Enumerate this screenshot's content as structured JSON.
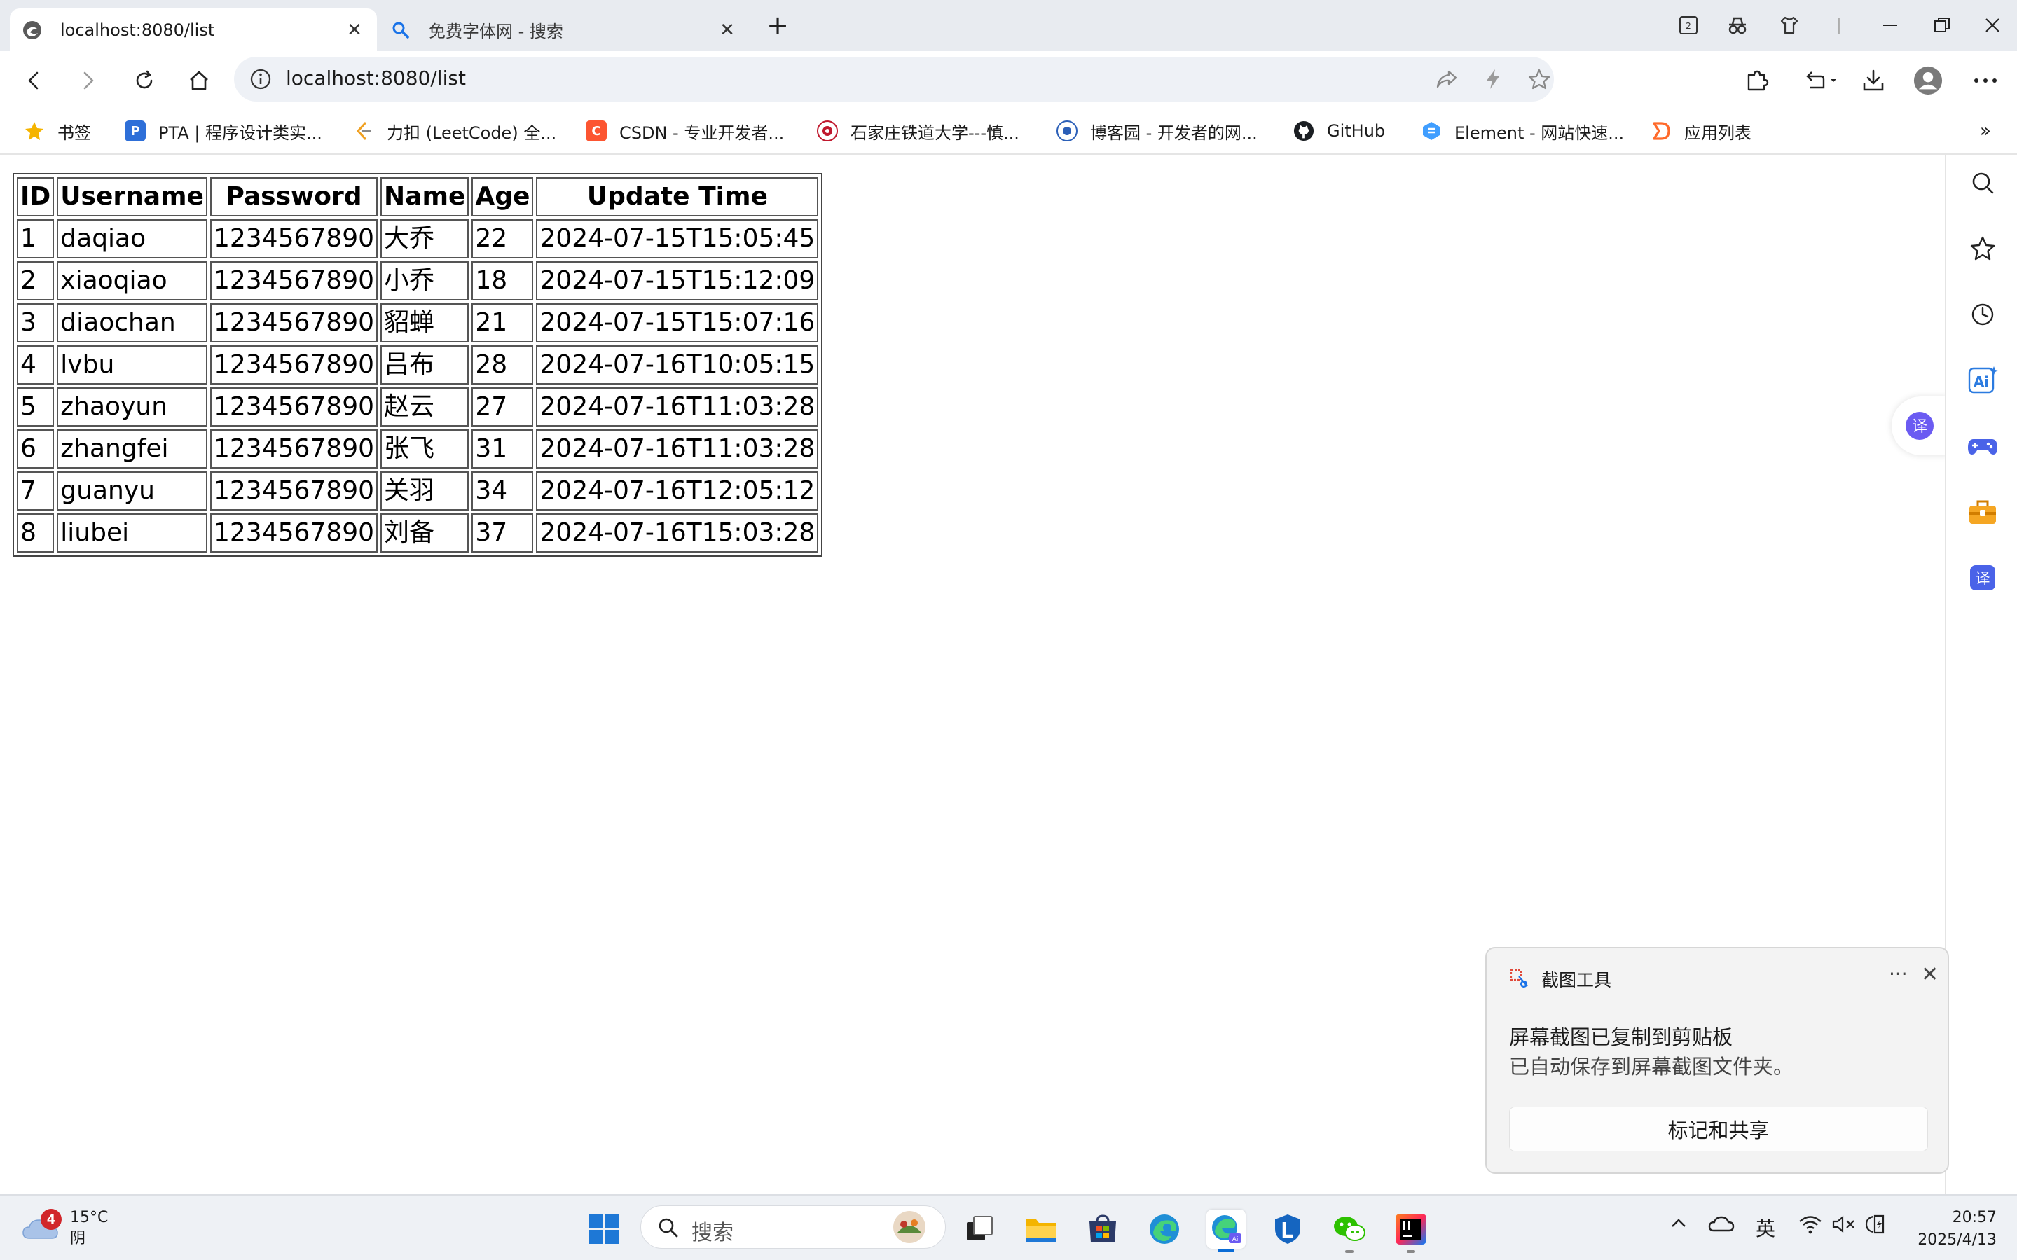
{
  "browser": {
    "tabs": [
      {
        "title": "localhost:8080/list",
        "active": true
      },
      {
        "title": "免费字体网 - 搜索",
        "active": false
      }
    ],
    "address": "localhost:8080/list",
    "icons": {
      "back": "back-arrow-icon",
      "forward": "forward-arrow-icon",
      "refresh": "refresh-icon",
      "home": "home-icon",
      "info": "info-icon",
      "share": "share-icon",
      "bolt": "lightning-icon",
      "favorite": "star-icon",
      "extensions": "puzzle-icon",
      "history": "history-icon",
      "download": "download-icon",
      "profile": "avatar-icon",
      "menu": "more-icon"
    }
  },
  "bookmarks": [
    {
      "label": "书签",
      "color": "#f5b400"
    },
    {
      "label": "PTA | 程序设计类实...",
      "color": "#2e6fd8"
    },
    {
      "label": "力扣 (LeetCode) 全...",
      "color": "#f0a020"
    },
    {
      "label": "CSDN - 专业开发者...",
      "color": "#fc5531"
    },
    {
      "label": "石家庄铁道大学---慎...",
      "color": "#c0182d"
    },
    {
      "label": "博客园 - 开发者的网...",
      "color": "#2b5fb8"
    },
    {
      "label": "GitHub",
      "color": "#1b1f23"
    },
    {
      "label": "Element - 网站快速...",
      "color": "#409eff"
    },
    {
      "label": "应用列表",
      "color": "#ff6a2b"
    }
  ],
  "bookmarks_overflow": "»",
  "table": {
    "headers": [
      "ID",
      "Username",
      "Password",
      "Name",
      "Age",
      "Update Time"
    ],
    "rows": [
      [
        "1",
        "daqiao",
        "1234567890",
        "大乔",
        "22",
        "2024-07-15T15:05:45"
      ],
      [
        "2",
        "xiaoqiao",
        "1234567890",
        "小乔",
        "18",
        "2024-07-15T15:12:09"
      ],
      [
        "3",
        "diaochan",
        "1234567890",
        "貂蝉",
        "21",
        "2024-07-15T15:07:16"
      ],
      [
        "4",
        "lvbu",
        "1234567890",
        "吕布",
        "28",
        "2024-07-16T10:05:15"
      ],
      [
        "5",
        "zhaoyun",
        "1234567890",
        "赵云",
        "27",
        "2024-07-16T11:03:28"
      ],
      [
        "6",
        "zhangfei",
        "1234567890",
        "张飞",
        "31",
        "2024-07-16T11:03:28"
      ],
      [
        "7",
        "guanyu",
        "1234567890",
        "关羽",
        "34",
        "2024-07-16T12:05:12"
      ],
      [
        "8",
        "liubei",
        "1234567890",
        "刘备",
        "37",
        "2024-07-16T15:03:28"
      ]
    ]
  },
  "sidebar": {
    "translate_label": "译",
    "ai_label": "Ai"
  },
  "toast": {
    "app_name": "截图工具",
    "more": "···",
    "close": "✕",
    "headline": "屏幕截图已复制到剪贴板",
    "body": "已自动保存到屏幕截图文件夹。",
    "action": "标记和共享"
  },
  "taskbar": {
    "weather_badge": "4",
    "temperature": "15°C",
    "condition": "阴",
    "search_placeholder": "搜索",
    "ime": "英",
    "time": "20:57",
    "date": "2025/4/13"
  },
  "tab_count_badge": "2",
  "colors": {
    "accent": "#0a6cd6",
    "tabstrip": "#e8ebf0"
  }
}
